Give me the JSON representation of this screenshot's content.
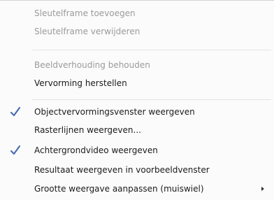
{
  "menu": {
    "items": [
      {
        "label": "Sleutelframe toevoegen",
        "enabled": false
      },
      {
        "label": "Sleutelframe verwijderen",
        "enabled": false
      },
      {
        "label": "Beeldverhouding behouden",
        "enabled": false
      },
      {
        "label": "Vervorming herstellen",
        "enabled": true
      },
      {
        "label": "Objectvervormingsvenster weergeven",
        "enabled": true,
        "checked": true
      },
      {
        "label": "Rasterlijnen weergeven...",
        "enabled": true
      },
      {
        "label": "Achtergrondvideo weergeven",
        "enabled": true,
        "checked": true
      },
      {
        "label": "Resultaat weergeven in voorbeeldvenster",
        "enabled": true
      },
      {
        "label": "Grootte weergave aanpassen (muiswiel)",
        "enabled": true,
        "submenu": true
      }
    ]
  },
  "colors": {
    "text": "#1a1a1a",
    "disabled_text": "#9a9a9a",
    "check": "#4a6fb0",
    "background": "#fbfbfb"
  }
}
